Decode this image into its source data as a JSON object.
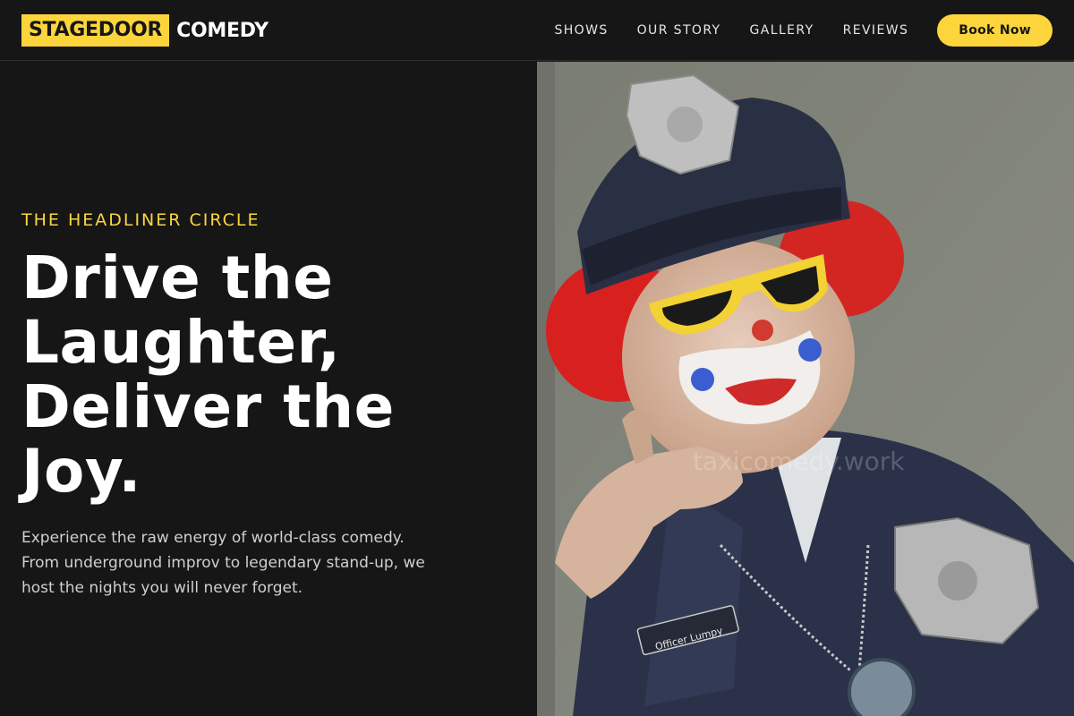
{
  "brand": {
    "mark": "STAGEDOOR",
    "word": "COMEDY"
  },
  "nav": {
    "links": [
      "SHOWS",
      "OUR STORY",
      "GALLERY",
      "REVIEWS"
    ],
    "cta": "Book Now"
  },
  "hero": {
    "eyebrow": "THE HEADLINER CIRCLE",
    "headline_lines": [
      "Drive the",
      "Laughter,",
      "Deliver the",
      "Joy."
    ],
    "lead": "Experience the raw energy of world-class comedy. From underground improv to legendary stand-up, we host the nights you will never forget.",
    "image": {
      "badge_text": "Officer Lumpy",
      "watermark": "taxicomedy.work"
    }
  },
  "colors": {
    "accent": "#fcd53c",
    "background": "#161616"
  }
}
